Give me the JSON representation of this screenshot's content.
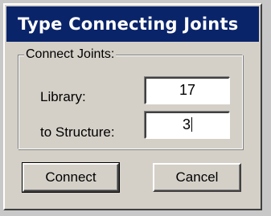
{
  "dialog": {
    "title": "Type Connecting Joints",
    "group_label": "Connect Joints:",
    "fields": {
      "library_label": "Library:",
      "library_value": "17",
      "structure_label": "to Structure:",
      "structure_value": "3"
    },
    "buttons": {
      "connect_label": "Connect",
      "cancel_label": "Cancel"
    }
  },
  "colors": {
    "title_bar": "#0a246a",
    "dialog_face": "#d4d0c8",
    "input_background": "#ffffff"
  }
}
